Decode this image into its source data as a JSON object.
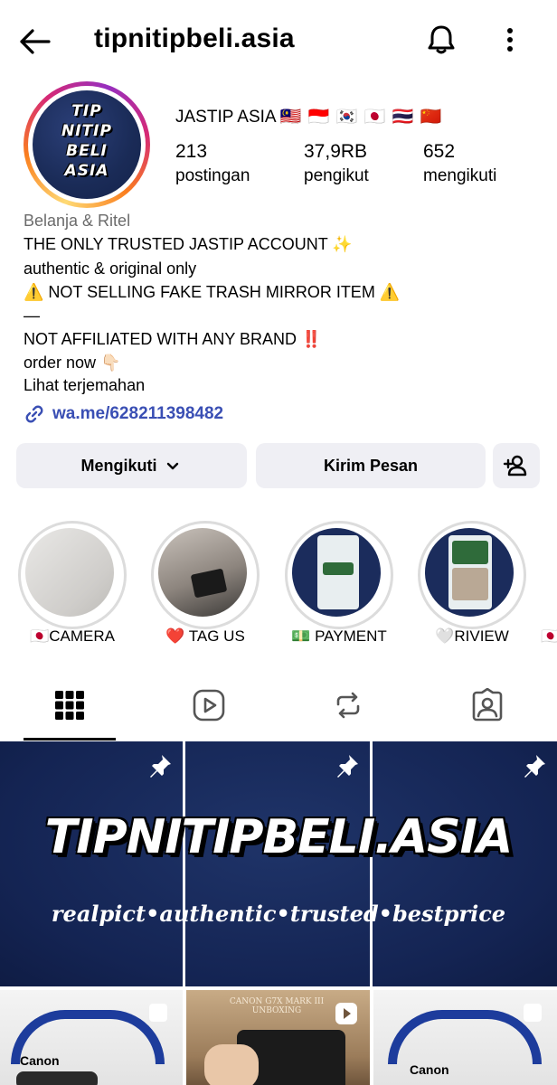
{
  "header": {
    "username": "tipnitipbeli.asia",
    "back_icon": "arrow-left-icon",
    "bell_icon": "bell-icon",
    "more_icon": "more-vertical-icon"
  },
  "profile": {
    "avatar_text": [
      "TIP",
      "NITIP",
      "BELI",
      "ASIA"
    ],
    "account_name": "JASTIP ASIA",
    "flags": "🇲🇾 🇮🇩 🇰🇷 🇯🇵 🇹🇭 🇨🇳",
    "stats": {
      "posts": {
        "value": "213",
        "label": "postingan"
      },
      "followers": {
        "value": "37,9RB",
        "label": "pengikut"
      },
      "following": {
        "value": "652",
        "label": "mengikuti"
      }
    },
    "category": "Belanja & Ritel",
    "bio": [
      "THE ONLY TRUSTED JASTIP ACCOUNT ✨",
      "authentic & original only",
      "⚠️ NOT SELLING FAKE TRASH MIRROR ITEM ⚠️",
      "—",
      "NOT AFFILIATED WITH ANY BRAND ‼️",
      "order now 👇🏻"
    ],
    "translate": "Lihat terjemahan",
    "link": "wa.me/628211398482",
    "link_color": "#3a4fb4"
  },
  "actions": {
    "follow_label": "Mengikuti",
    "message_label": "Kirim Pesan",
    "add_user_icon": "add-person-icon"
  },
  "highlights": [
    {
      "label": "🇯🇵CAMERA"
    },
    {
      "label": "❤️ TAG US"
    },
    {
      "label": "💵 PAYMENT"
    },
    {
      "label": "🤍RIVIEW"
    },
    {
      "label": "🇯🇵"
    }
  ],
  "tabs": [
    "grid-icon",
    "reels-icon",
    "repost-icon",
    "tagged-icon"
  ],
  "banner": {
    "title": "TIPNITIPBELI.ASIA",
    "subtitle": "realpict•authentic•trusted•bestprice",
    "bg_color": "#142453"
  },
  "grid_bottom": [
    {
      "caption": "Canon"
    },
    {
      "caption": "CANON G7X MARK III UNBOXING"
    },
    {
      "caption": "Canon"
    }
  ]
}
